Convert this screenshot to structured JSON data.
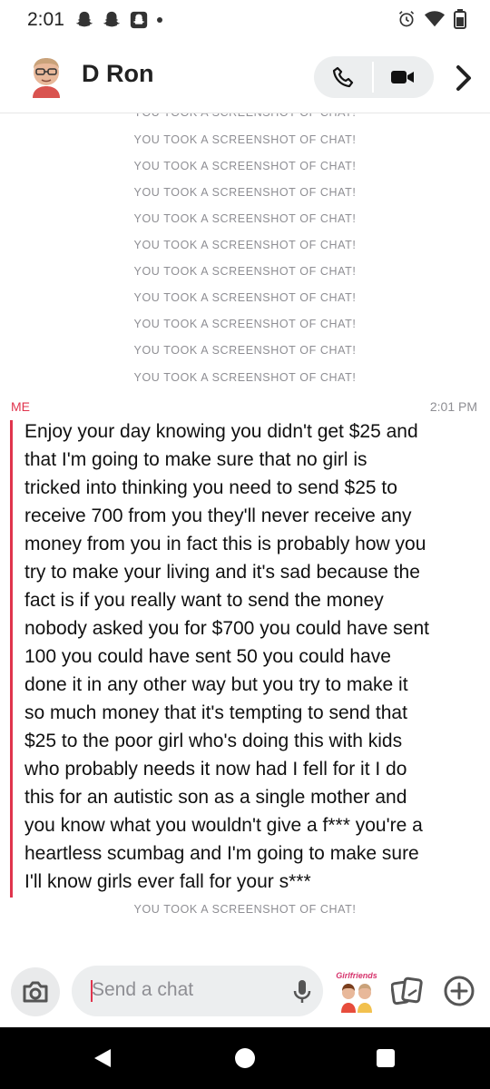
{
  "status_bar": {
    "time": "2:01"
  },
  "header": {
    "contact_name": "D Ron"
  },
  "chat": {
    "system_notice": "YOU TOOK A SCREENSHOT OF CHAT!",
    "sender_label": "ME",
    "message_time": "2:01 PM",
    "message_lines": [
      "Enjoy your day knowing you didn't get $25 and",
      "that I'm going to make sure that no girl is",
      "tricked into thinking you need to send $25 to",
      "receive 700 from you they'll never receive any",
      "money from you in fact this is probably how you",
      "try to make your living and it's sad because the",
      "fact is if you really want to send the money",
      "nobody asked you for $700 you could have sent",
      "100 you could have sent 50 you could have",
      "done it in any other way but you try to make it",
      "so much money that it's tempting to send that",
      "$25 to the poor girl who's doing this with kids",
      "who probably needs it now had I fell for it I do",
      "this for an autistic son as a single mother and",
      "you know what you wouldn't give a f*** you're a",
      "heartless scumbag and I'm going to make sure",
      "I'll know girls ever fall for your s***"
    ]
  },
  "composer": {
    "placeholder": "Send a chat",
    "bitmoji_label": "Girlfriends"
  },
  "colors": {
    "accent_red": "#e0344d",
    "system_gray": "#8e8e93",
    "button_gray": "#eceeef"
  },
  "icons": [
    "snapchat-ghost-icon",
    "alarm-icon",
    "wifi-icon",
    "battery-icon",
    "phone-icon",
    "video-icon",
    "chevron-right-icon",
    "camera-icon",
    "microphone-icon",
    "cards-icon",
    "plus-icon",
    "back-nav-icon",
    "home-nav-icon",
    "recents-nav-icon"
  ]
}
